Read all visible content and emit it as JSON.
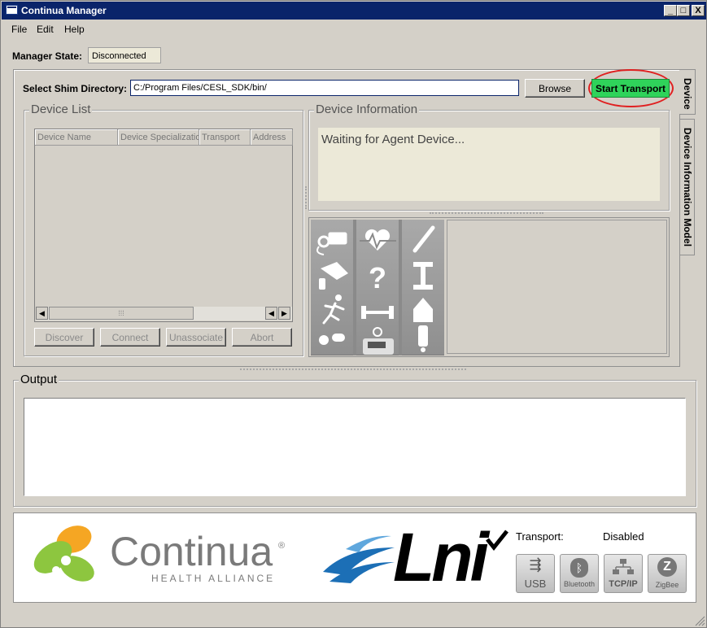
{
  "window": {
    "title": "Continua Manager",
    "controls": {
      "minimize": "_",
      "maximize": "□",
      "close": "X"
    }
  },
  "menu": {
    "file": "File",
    "edit": "Edit",
    "help": "Help"
  },
  "manager": {
    "state_label": "Manager State:",
    "state_value": "Disconnected"
  },
  "shim": {
    "label": "Select Shim Directory:",
    "path": "C:/Program Files/CESL_SDK/bin/",
    "browse": "Browse",
    "start": "Start Transport"
  },
  "tabs": {
    "device": "Device",
    "dim": "Device Information Model"
  },
  "device_list": {
    "title": "Device List",
    "columns": [
      "Device Name",
      "Device Specializatio",
      "Transport",
      "Address"
    ],
    "buttons": {
      "discover": "Discover",
      "connect": "Connect",
      "unassociate": "Unassociate",
      "abort": "Abort"
    }
  },
  "device_info": {
    "title": "Device Information",
    "message": "Waiting for Agent Device..."
  },
  "output": {
    "title": "Output",
    "text": ""
  },
  "logos": {
    "continua": "Continua",
    "continua_sub": "HEALTH ALLIANCE",
    "lni": "Lni",
    "registered": "®"
  },
  "transport": {
    "label": "Transport:",
    "value": "Disabled",
    "buttons": {
      "usb": "USB",
      "bluetooth": "Bluetooth",
      "tcpip": "TCP/IP",
      "zigbee": "ZigBee"
    }
  },
  "colors": {
    "start_button": "#2fd35a",
    "highlight_ring": "#e02020",
    "title_bar": "#0a246a"
  }
}
